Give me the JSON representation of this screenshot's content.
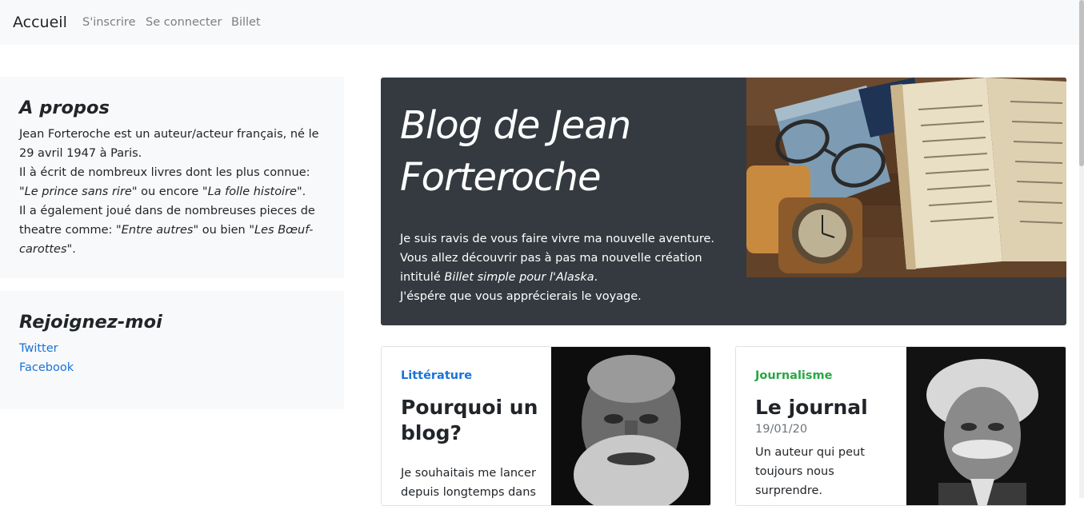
{
  "navbar": {
    "brand": "Accueil",
    "links": [
      "S'inscrire",
      "Se connecter",
      "Billet"
    ]
  },
  "about": {
    "title": "A propos",
    "line1": "Jean Forteroche est un auteur/acteur français, né le 29 avril 1947 à Paris.",
    "line2_prefix": "Il à écrit de nombreux livres dont les plus connue: \"",
    "line2_book1": "Le prince sans rire",
    "line2_mid": "\" ou encore \"",
    "line2_book2": "La folle histoire",
    "line2_suffix": "\".",
    "line3_prefix": "Il a également joué dans de nombreuses pieces de theatre comme: \"",
    "line3_play1": "Entre autres",
    "line3_mid": "\" ou bien \"",
    "line3_play2": "Les Bœuf-carottes",
    "line3_suffix": "\"."
  },
  "join": {
    "title": "Rejoignez-moi",
    "links": [
      "Twitter",
      "Facebook"
    ]
  },
  "hero": {
    "title": "Blog de Jean Forteroche",
    "line1": "Je suis ravis de vous faire vivre ma nouvelle aventure.",
    "line2": "Vous allez découvrir pas à pas ma nouvelle création intitulé ",
    "book": "Billet simple pour l'Alaska",
    "line2_end": ".",
    "line3": "J'éspére que vous apprécierais le voyage."
  },
  "cards": [
    {
      "category": "Littérature",
      "category_color": "#1a73d9",
      "title": "Pourquoi un blog?",
      "text": "Je souhaitais me lancer depuis longtemps dans"
    },
    {
      "category": "Journalisme",
      "category_color": "#28a745",
      "title": "Le journal",
      "date": "19/01/20",
      "text": "Un auteur qui peut toujours nous surprendre."
    }
  ],
  "colors": {
    "link": "#1a73d9",
    "hero_bg": "#343a40",
    "navbar_bg": "#f8f9fa"
  }
}
